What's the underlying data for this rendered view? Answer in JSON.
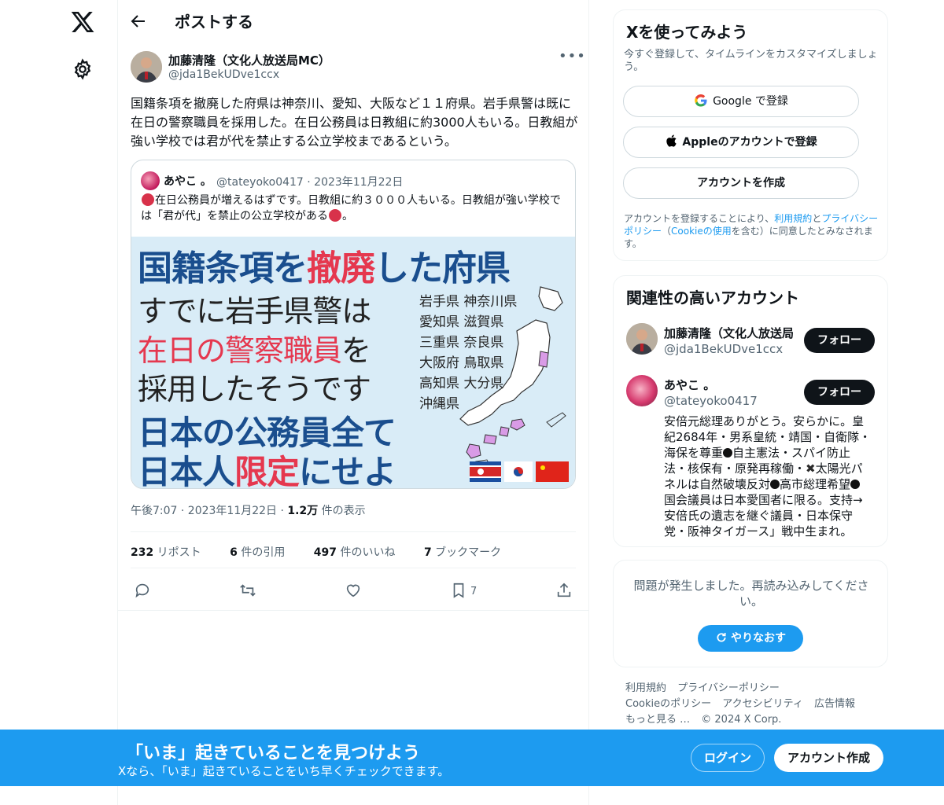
{
  "header": {
    "title": "ポストする"
  },
  "tweet": {
    "author_name": "加藤清隆（文化人放送局MC）",
    "author_handle": "@jda1BekUDve1ccx",
    "text": "国籍条項を撤廃した府県は神奈川、愛知、大阪など１１府県。岩手県警は既に在日の警察職員を採用した。在日公務員は日教組に約3000人もいる。日教組が強い学校では君が代を禁止する公立学校まであるという。",
    "time": "午後7:07 · 2023年11月22日 · ",
    "views_count": "1.2万",
    "views_label": " 件の表示",
    "stats": {
      "reposts_count": "232",
      "reposts_label": "リポスト",
      "quotes_count": "6",
      "quotes_label": "件の引用",
      "likes_count": "497",
      "likes_label": "件のいいね",
      "bookmarks_count": "7",
      "bookmarks_label": "ブックマーク"
    },
    "bookmark_action_count": "7"
  },
  "quote": {
    "name": "あやこ 。",
    "handle": "@tateyoko0417 · 2023年11月22日",
    "text_part1": "在日公務員が増えるはずです。日教組に約３０００人もいる。日教組が強い学校では「君が代」を禁止の公立学校がある",
    "text_part2": "。",
    "image": {
      "title_a": "国籍条項を",
      "title_b": "撤廃",
      "title_c": "した府県",
      "line1": "すでに岩手県警は",
      "line2_a": "在日の警察職員",
      "line2_b": "を",
      "line3": "採用したそうです",
      "big1": "日本の公務員全て",
      "big2_a": "日本人",
      "big2_b": "限定",
      "big2_c": "にせよ",
      "prefs": [
        "岩手県 神奈川県",
        "愛知県 滋賀県",
        "三重県 奈良県",
        "大阪府 鳥取県",
        "高知県 大分県",
        "沖縄県"
      ]
    }
  },
  "signup": {
    "title": "Xを使ってみよう",
    "subtitle": "今すぐ登録して、タイムラインをカスタマイズしましょう。",
    "google": "Google で登録",
    "apple": "Appleのアカウントで登録",
    "create": "アカウントを作成",
    "terms_1": "アカウントを登録することにより、",
    "terms_link1": "利用規約",
    "terms_2": "と",
    "terms_link2": "プライバシーポリシー",
    "terms_3": "（",
    "terms_link3": "Cookieの使用",
    "terms_4": "を含む）に同意したとみなされます。"
  },
  "related": {
    "title": "関連性の高いアカウント",
    "accounts": [
      {
        "name": "加藤清隆（文化人放送局",
        "handle": "@jda1BekUDve1ccx",
        "follow": "フォロー"
      },
      {
        "name": "あやこ 。",
        "handle": "@tateyoko0417",
        "follow": "フォロー",
        "bio_1": "安倍元総理ありがとう。安らかに。皇紀2684年・男系皇統・靖国・自衛隊・海保を尊重",
        "bio_2": "自主憲法・スパイ防止法・核保有・原発再稼働・",
        "bio_3": "太陽光パネルは自然破壊反対",
        "bio_4": "高市総理希望",
        "bio_5": "国会議員は日本愛国者に限る。支持→安倍氏の遺志を継ぐ議員・日本保守党・阪神タイガース」戦中生まれ。"
      }
    ]
  },
  "error": {
    "text": "問題が発生しました。再読み込みしてください。",
    "retry": "やりなおす"
  },
  "footer": {
    "links": [
      "利用規約",
      "プライバシーポリシー",
      "Cookieのポリシー",
      "アクセシビリティ",
      "広告情報",
      "もっと見る …"
    ],
    "copyright": "© 2024 X Corp."
  },
  "bottom_bar": {
    "title": "「いま」起きていることを見つけよう",
    "subtitle": "Xなら、「いま」起きていることをいち早くチェックできます。",
    "login": "ログイン",
    "signup": "アカウント作成"
  },
  "colors": {
    "accent": "#1d9bf0",
    "text": "#0f1419",
    "muted": "#536471"
  },
  "icons": [
    "x-logo-icon",
    "gear-icon",
    "back-arrow-icon",
    "more-icon",
    "reply-icon",
    "repost-icon",
    "like-icon",
    "bookmark-icon",
    "share-icon",
    "google-icon",
    "apple-icon",
    "refresh-icon"
  ]
}
